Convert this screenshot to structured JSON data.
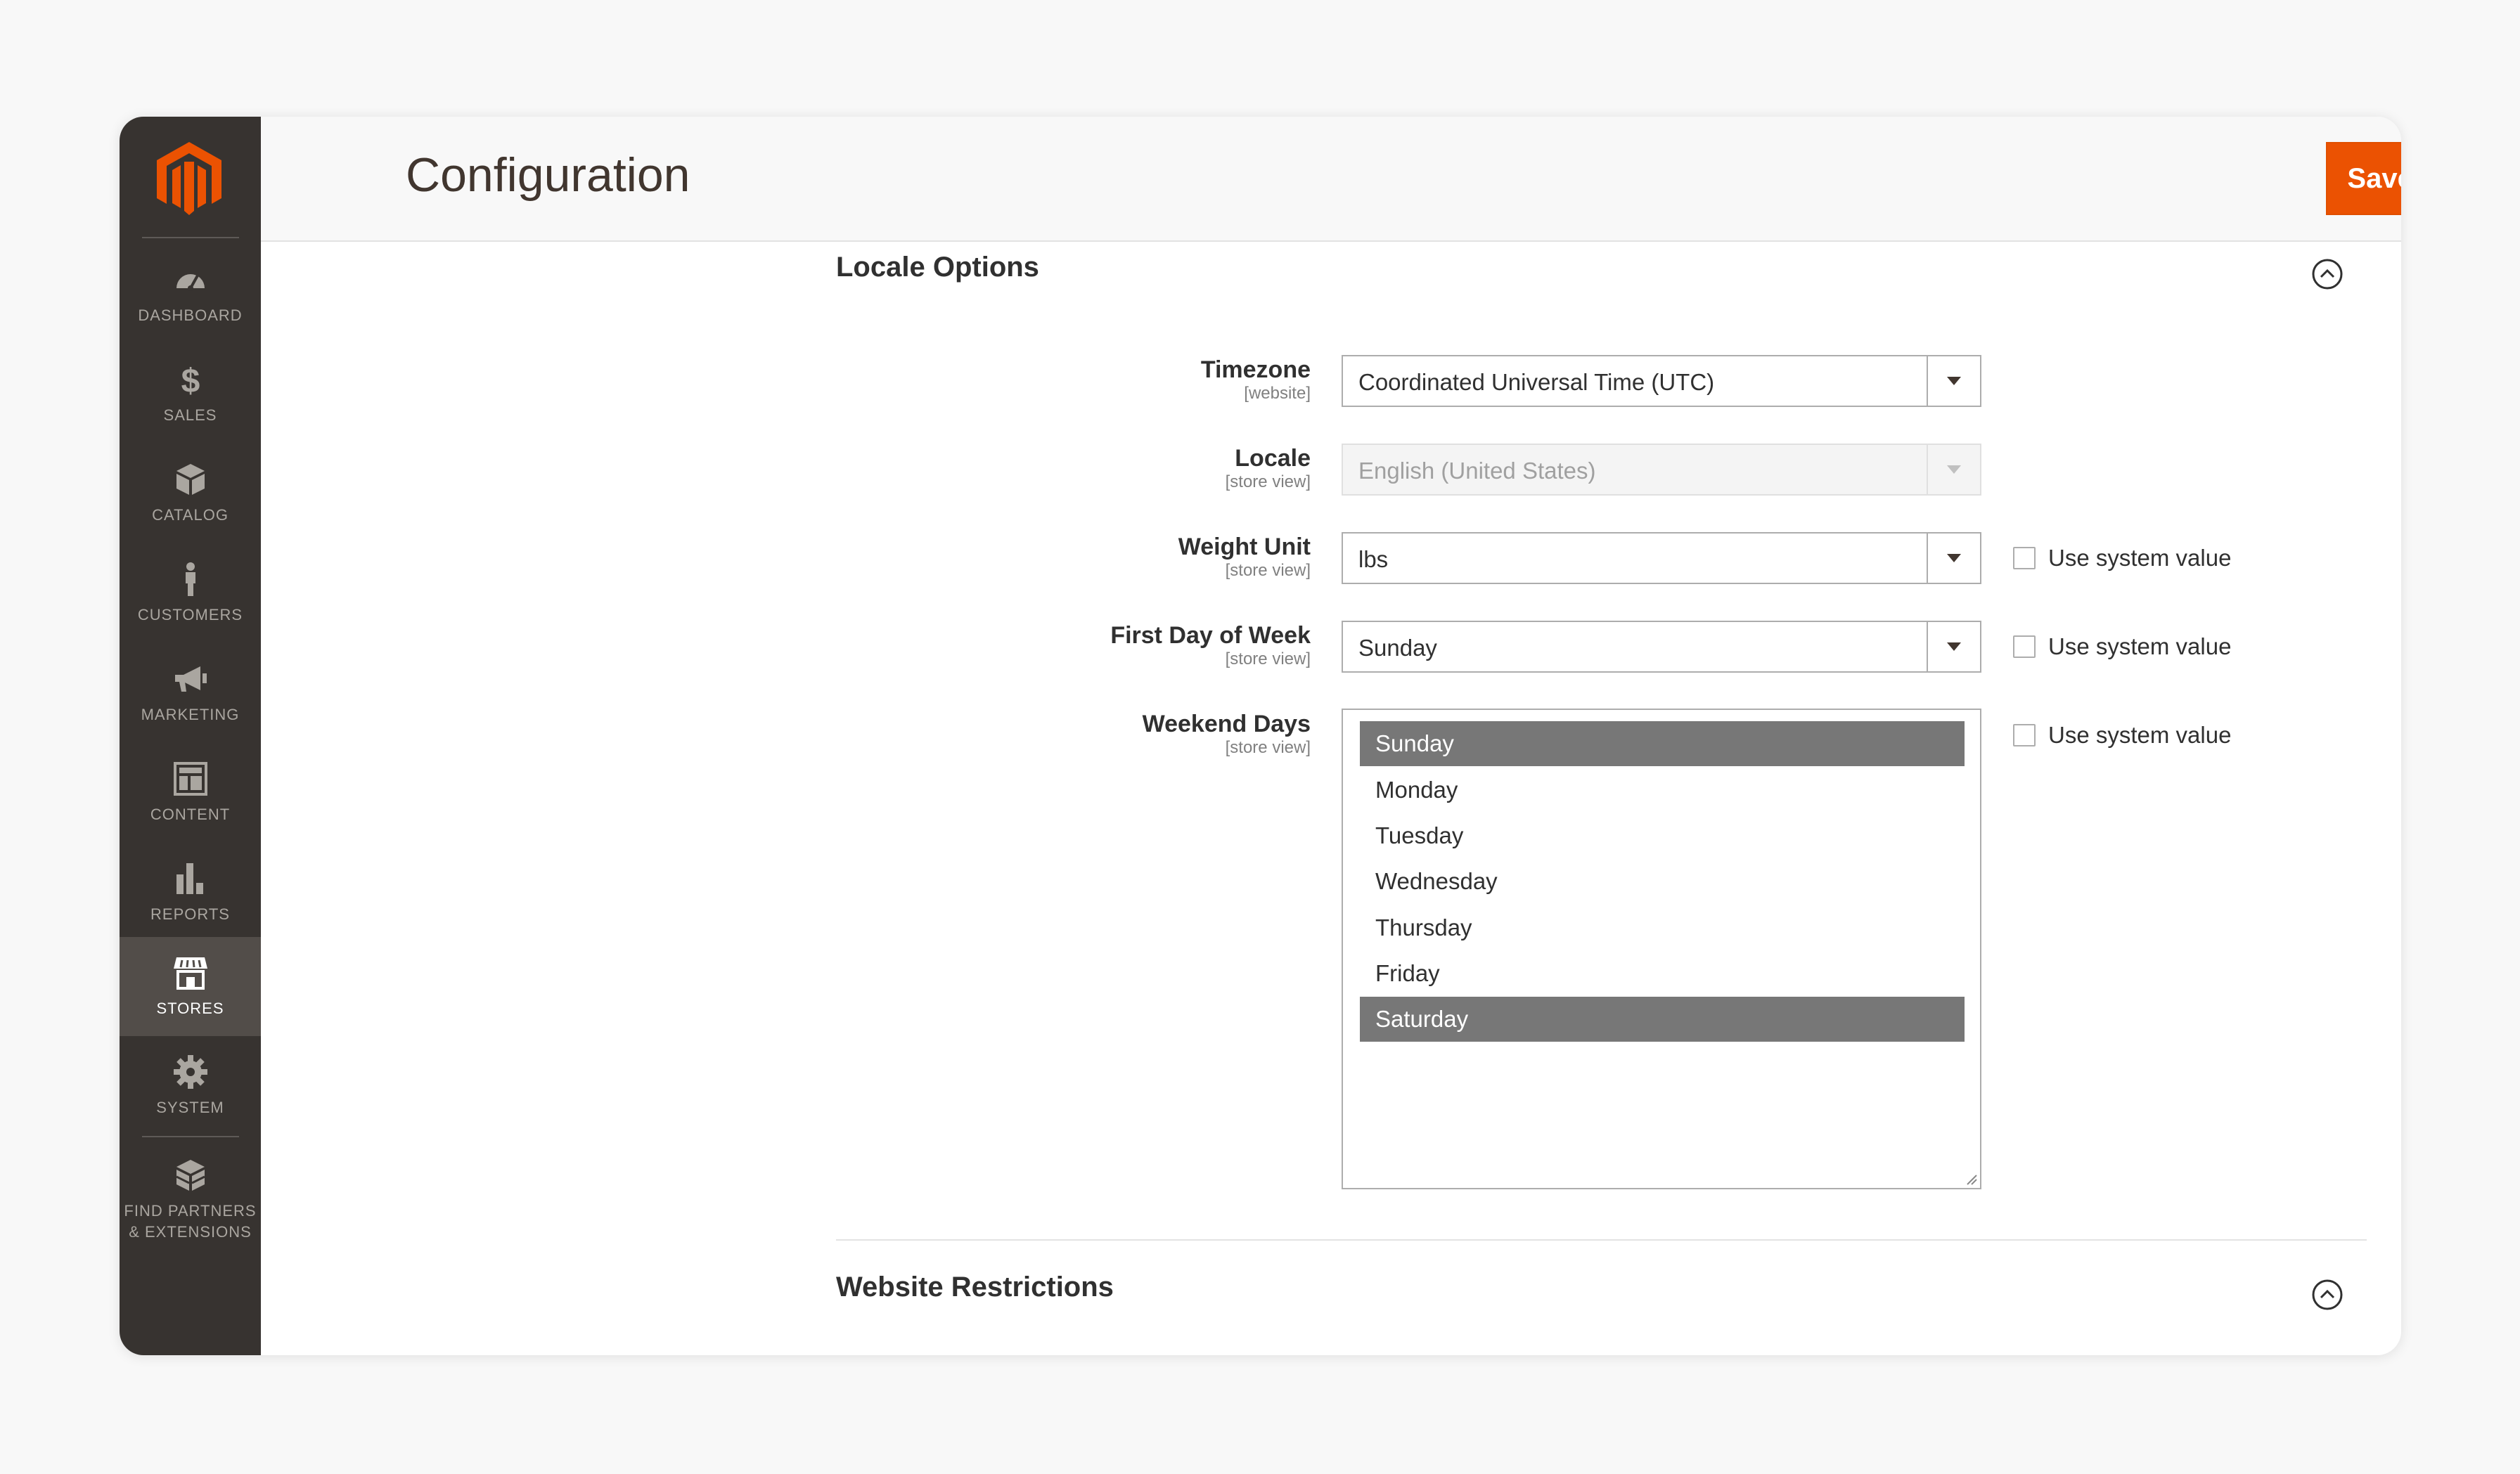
{
  "app": {
    "title": "Configuration",
    "save_label": "Save Config",
    "accent_color": "#eb5202"
  },
  "sidebar": {
    "logo": "magento-logo",
    "items": [
      {
        "label": "DASHBOARD",
        "icon": "dashboard-icon"
      },
      {
        "label": "SALES",
        "icon": "dollar-icon"
      },
      {
        "label": "CATALOG",
        "icon": "box-icon"
      },
      {
        "label": "CUSTOMERS",
        "icon": "person-icon"
      },
      {
        "label": "MARKETING",
        "icon": "megaphone-icon"
      },
      {
        "label": "CONTENT",
        "icon": "layout-icon"
      },
      {
        "label": "REPORTS",
        "icon": "bar-chart-icon"
      },
      {
        "label": "STORES",
        "icon": "storefront-icon",
        "active": true
      },
      {
        "label": "SYSTEM",
        "icon": "gear-icon"
      },
      {
        "label": "FIND PARTNERS & EXTENSIONS",
        "icon": "blocks-icon"
      }
    ]
  },
  "locale_options": {
    "title": "Locale Options",
    "fields": {
      "timezone": {
        "label": "Timezone",
        "scope": "[website]",
        "value": "Coordinated Universal Time (UTC)"
      },
      "locale": {
        "label": "Locale",
        "scope": "[store view]",
        "value": "English (United States)",
        "disabled": true
      },
      "weight_unit": {
        "label": "Weight Unit",
        "scope": "[store view]",
        "value": "lbs",
        "use_system_value": "Use system value"
      },
      "first_day": {
        "label": "First Day of Week",
        "scope": "[store view]",
        "value": "Sunday",
        "use_system_value": "Use system value"
      },
      "weekend_days": {
        "label": "Weekend Days",
        "scope": "[store view]",
        "use_system_value": "Use system value",
        "options": [
          "Sunday",
          "Monday",
          "Tuesday",
          "Wednesday",
          "Thursday",
          "Friday",
          "Saturday"
        ],
        "selected": [
          "Sunday",
          "Saturday"
        ]
      }
    }
  },
  "website_restrictions": {
    "title": "Website Restrictions"
  }
}
